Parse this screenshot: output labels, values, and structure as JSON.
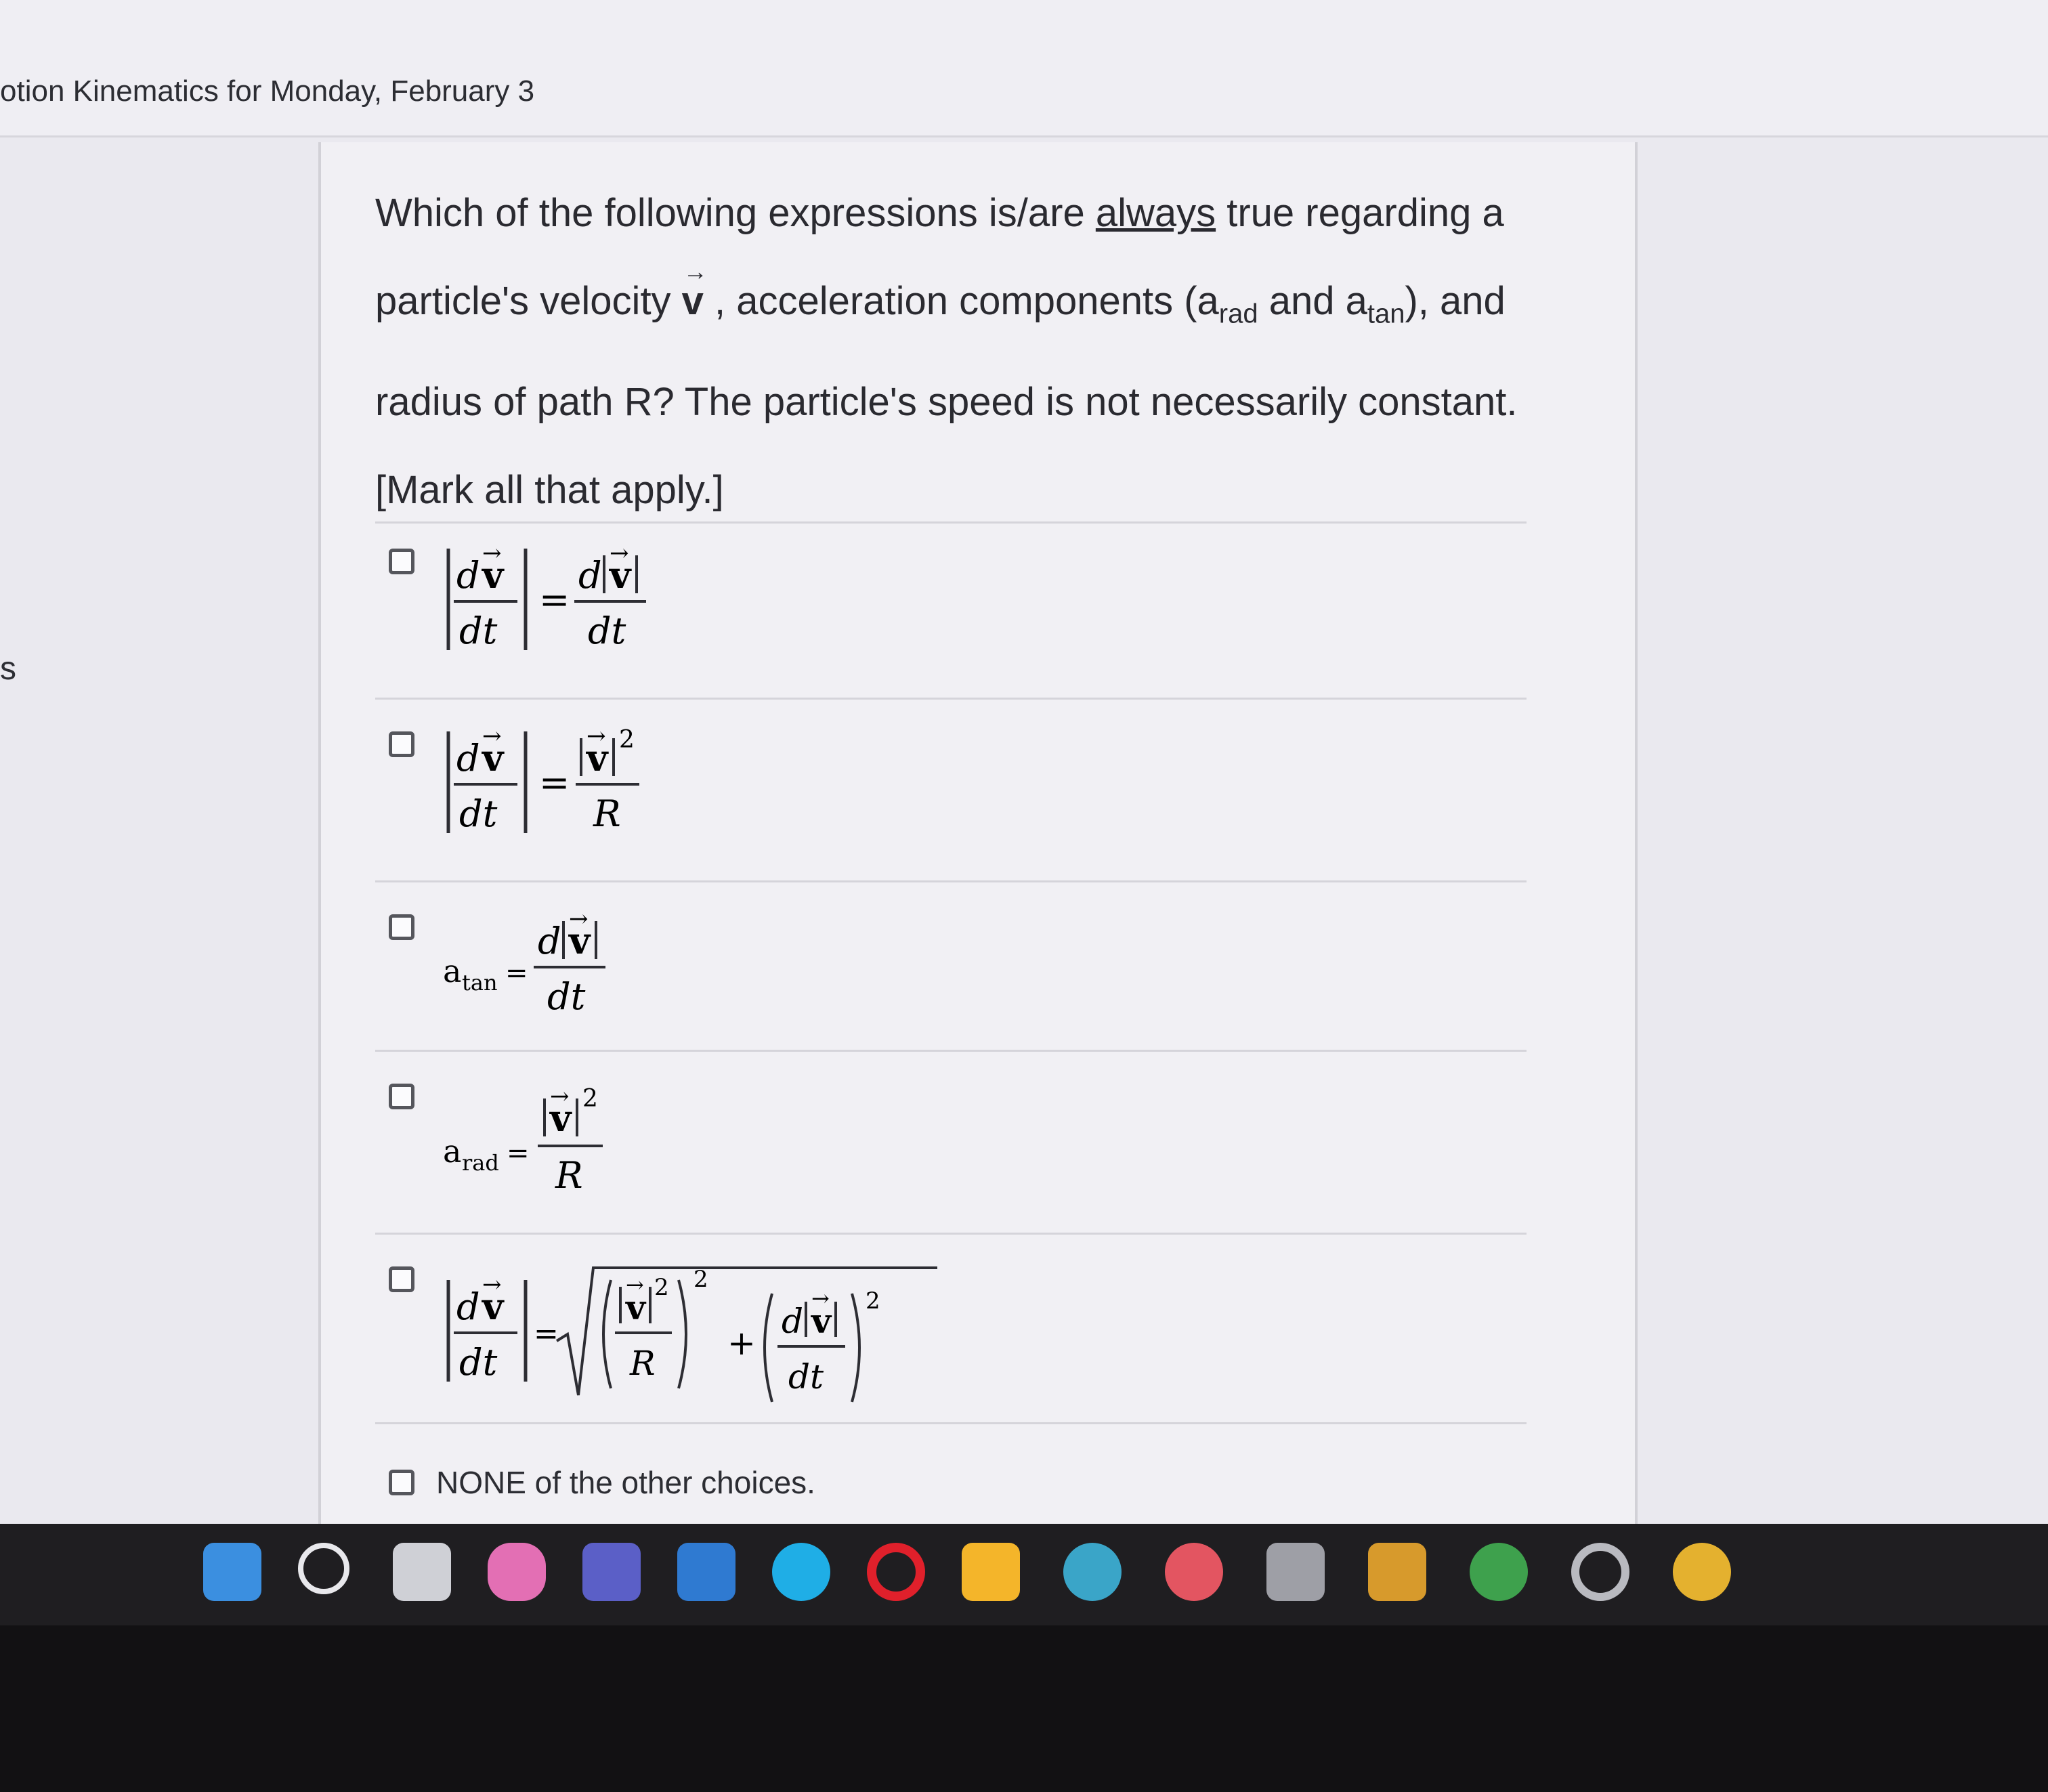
{
  "page": {
    "title": "otion Kinematics for Monday, February 3",
    "side_letter": "s"
  },
  "question": {
    "part1": "Which of the following expressions is/are ",
    "emphasis": "always",
    "part2": " true regarding a particle's velocity ",
    "vector": "v",
    "part3": " , acceleration components (a",
    "sub_rad": "rad",
    "part4": " and a",
    "sub_tan": "tan",
    "part5": "), and radius of path R?  The particle's speed is not necessarily constant. [Mark all that apply.]"
  },
  "choices": [
    {
      "id": "choice-1",
      "expr": "|dv/dt| = d|v|/dt"
    },
    {
      "id": "choice-2",
      "expr": "|dv/dt| = |v|^2/R"
    },
    {
      "id": "choice-3",
      "expr": "a_tan = d|v|/dt"
    },
    {
      "id": "choice-4",
      "expr": "a_rad = |v|^2/R"
    },
    {
      "id": "choice-5",
      "expr": "|dv/dt| = sqrt((|v|^2/R)^2 + (d|v|/dt)^2)"
    },
    {
      "id": "choice-6",
      "label": "NONE of the other choices."
    }
  ],
  "math": {
    "d": "d",
    "dt": "dt",
    "v": "v",
    "R": "R",
    "eq": "=",
    "plus": "+",
    "two": "2",
    "a": "a",
    "tan": "tan",
    "rad": "rad"
  },
  "taskbar": {
    "icons": [
      "windows-start-icon",
      "search-icon",
      "task-view-icon",
      "copilot-icon",
      "teams-icon",
      "store-icon",
      "edge-icon",
      "opera-icon",
      "file-explorer-icon",
      "browser-icon",
      "app-icon",
      "snipping-tool-icon",
      "media-app-icon",
      "chrome-profile-icon",
      "settings-icon",
      "chrome-icon"
    ]
  }
}
